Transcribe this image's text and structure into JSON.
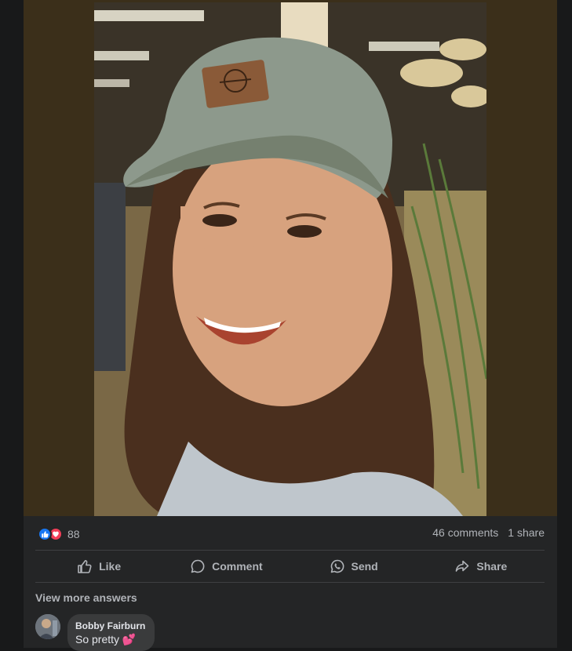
{
  "post": {
    "reaction_count": "88",
    "comments_label": "46 comments",
    "shares_label": "1 share",
    "image_alt": "Smiling woman wearing a grey cap"
  },
  "actions": {
    "like": "Like",
    "comment": "Comment",
    "send": "Send",
    "share": "Share"
  },
  "comments": {
    "view_more": "View more answers",
    "items": [
      {
        "author": "Bobby Fairburn",
        "text": "So pretty",
        "emoji": "💕"
      }
    ]
  },
  "colors": {
    "background": "#18191a",
    "card": "#242526",
    "like_blue": "#1877f2",
    "love_red": "#f33e58",
    "muted_text": "#b0b3b8"
  },
  "icons": [
    "like-reaction-icon",
    "love-reaction-icon",
    "thumbs-up-icon",
    "comment-icon",
    "whatsapp-send-icon",
    "share-arrow-icon"
  ]
}
